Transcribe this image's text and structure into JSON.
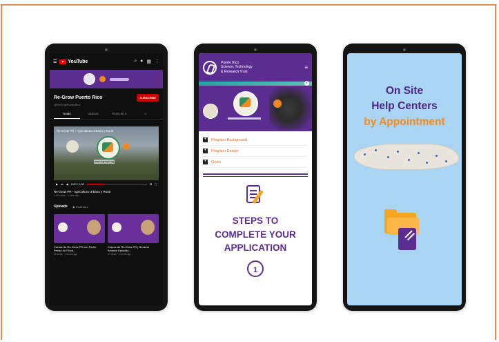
{
  "youtube": {
    "logo_text": "YouTube",
    "channel_name": "Re-Grow Puerto Rico",
    "channel_handle": "@ReGrowPuertoRico",
    "subscribe_label": "SUBSCRIBE",
    "tabs": [
      {
        "label": "HOME"
      },
      {
        "label": "VIDEOS"
      },
      {
        "label": "PLAYLISTS"
      },
      {
        "label": "C"
      }
    ],
    "video": {
      "overlay_title": "Re-Grow PR - Agricultura Urbana y Rural",
      "caption": "www.regrowpr.org",
      "time": "0:00 / 1:00",
      "title": "Re-Grow PR - Agricultura Urbana y Rural",
      "meta": "1.2K views · 1 year ago"
    },
    "uploads_label": "Uploads",
    "play_all_label": "PLAY ALL",
    "thumbs": [
      {
        "title": "Cursos de Re-Grow PR con Pedro Presto en Finca...",
        "meta": "25 views · 1 month ago"
      },
      {
        "title": "Cursos de Re-Grow PR | Gerardo Amador Episodio...",
        "meta": "17 views · 1 month ago"
      }
    ]
  },
  "trust": {
    "org_name_1": "Puerto Rico",
    "org_name_2": "Science, Technology",
    "org_name_3": "& Research Trust",
    "close_label": "x",
    "links": [
      {
        "label": "Program Background"
      },
      {
        "label": "Program Design"
      },
      {
        "label": "Goals"
      }
    ],
    "steps_1": "STEPS TO",
    "steps_2": "COMPLETE YOUR",
    "steps_3": "APPLICATION",
    "step_number": "1"
  },
  "help": {
    "title_1": "On Site",
    "title_2": "Help Centers",
    "title_3": "by Appointment"
  },
  "colors": {
    "purple": "#5c2d91",
    "orange": "#f28c1e",
    "sky": "#a9d4f4",
    "frame": "#e8884a"
  }
}
